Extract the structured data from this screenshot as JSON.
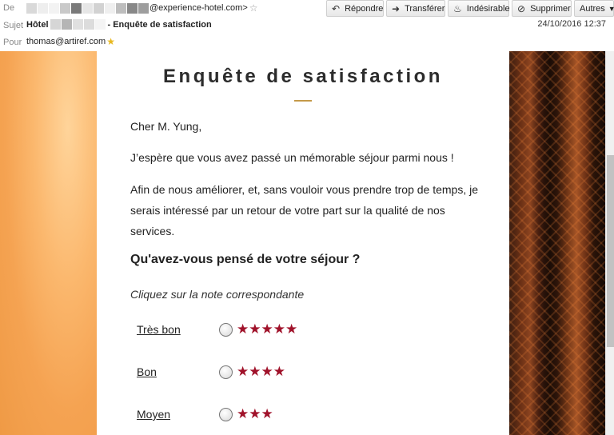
{
  "header": {
    "from_label": "De",
    "from_value": "@experience-hotel.com>",
    "subject_label": "Sujet",
    "subject_start": "Hôtel",
    "subject_value": "- Enquête de satisfaction",
    "to_label": "Pour",
    "to_value": "thomas@artiref.com",
    "date": "24/10/2016 12:37"
  },
  "toolbar": {
    "reply": "Répondre",
    "forward": "Transférer",
    "junk": "Indésirable",
    "delete": "Supprimer",
    "more": "Autres"
  },
  "email": {
    "title": "Enquête de satisfaction",
    "greeting": "Cher M. Yung,",
    "line1": "J’espère que vous avez passé un mémorable séjour parmi nous !",
    "line2": "Afin de nous améliorer, et, sans vouloir vous prendre trop de temps, je serais intéressé par un retour de votre part sur la qualité de nos services.",
    "question": "Qu'avez-vous pensé de votre séjour ?",
    "hint": "Cliquez sur la note correspondante",
    "ratings": [
      {
        "label": "Très bon",
        "stars": "★★★★★"
      },
      {
        "label": "Bon",
        "stars": "★★★★"
      },
      {
        "label": "Moyen",
        "stars": "★★★"
      }
    ]
  },
  "colors": {
    "accent_rule": "#c49a4a",
    "star": "#a0122a"
  }
}
